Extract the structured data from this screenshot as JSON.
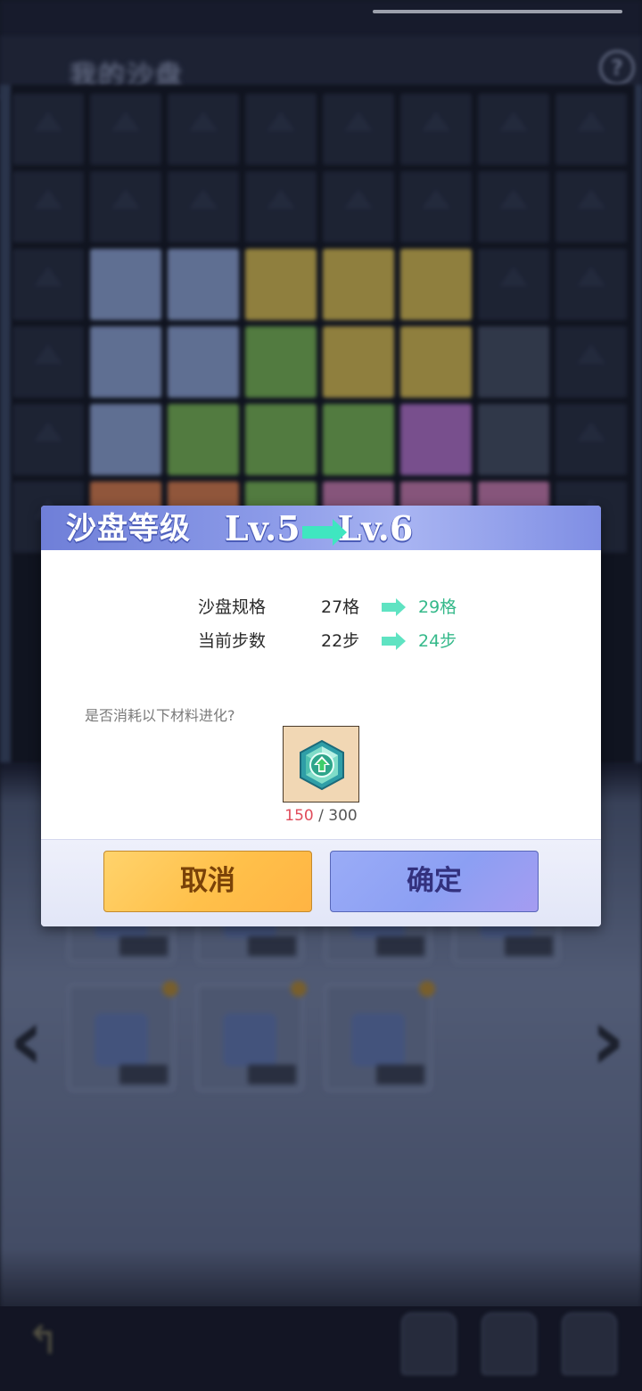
{
  "background": {
    "title": "我的沙盘",
    "help_label": "?",
    "nav_prev": "‹",
    "nav_next": "›",
    "back_icon": "back-arrow-icon",
    "board": [
      [
        "empty",
        "empty",
        "empty",
        "empty",
        "empty",
        "empty",
        "empty",
        "empty"
      ],
      [
        "empty",
        "empty",
        "empty",
        "empty",
        "empty",
        "empty",
        "empty",
        "empty"
      ],
      [
        "empty",
        "blue",
        "blue",
        "gold",
        "gold",
        "gold",
        "empty",
        "empty"
      ],
      [
        "empty",
        "blue",
        "blue",
        "green",
        "gold",
        "gold",
        "slate",
        "empty"
      ],
      [
        "empty",
        "blue",
        "green",
        "green",
        "green",
        "purple",
        "slate",
        "empty"
      ],
      [
        "empty",
        "orange",
        "orange",
        "green",
        "pink",
        "pink",
        "pink",
        "empty"
      ]
    ]
  },
  "dialog": {
    "title": "沙盘等级",
    "level_from": "Lv.5",
    "level_to": "Lv.6",
    "stats": [
      {
        "label": "沙盘规格",
        "from": "27格",
        "to": "29格"
      },
      {
        "label": "当前步数",
        "from": "22步",
        "to": "24步"
      }
    ],
    "question": "是否消耗以下材料进化?",
    "material": {
      "icon": "upgrade-crystal-icon",
      "current": "150",
      "separator": " / ",
      "required": "300"
    },
    "cancel_label": "取消",
    "confirm_label": "确定"
  },
  "colors": {
    "header_accent": "#7f8ee4",
    "stat_increase": "#35b98a",
    "material_insufficient": "#e04b5a",
    "cancel_button": "#ffc04a",
    "confirm_button": "#8c9ff3"
  }
}
